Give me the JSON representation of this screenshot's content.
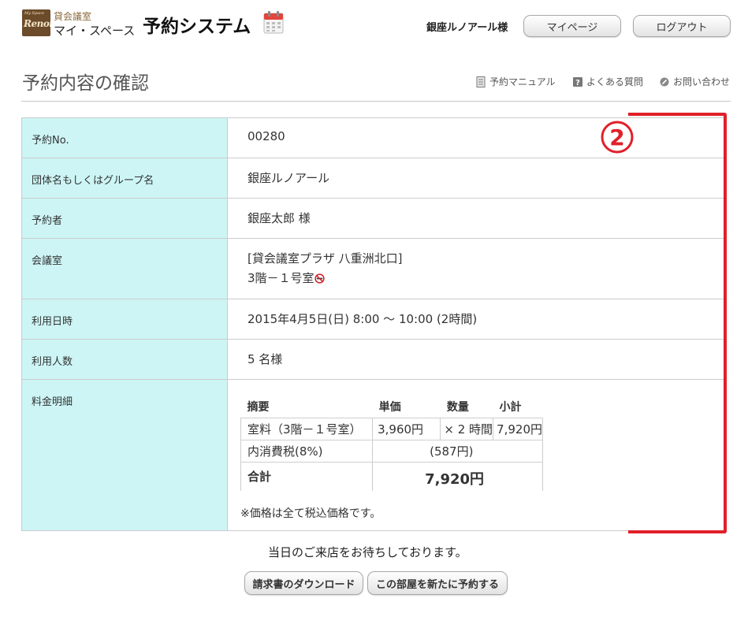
{
  "header": {
    "logo": {
      "small_text": "My Space",
      "script_text": "Renoir"
    },
    "brand_line1": "貸会議室",
    "brand_line2": "マイ・スペース",
    "system_title": "予約システム",
    "user_name": "銀座ルノアール様",
    "mypage_label": "マイページ",
    "logout_label": "ログアウト"
  },
  "page": {
    "title": "予約内容の確認",
    "links": [
      {
        "label": "予約マニュアル",
        "icon": "manual-icon"
      },
      {
        "label": "よくある質問",
        "icon": "question-icon"
      },
      {
        "label": "お問い合わせ",
        "icon": "contact-icon"
      }
    ]
  },
  "reservation": {
    "rows": [
      {
        "label": "予約No.",
        "value": "00280"
      },
      {
        "label": "団体名もしくはグループ名",
        "value": "銀座ルノアール"
      },
      {
        "label": "予約者",
        "value": "銀座太郎 様"
      },
      {
        "label": "会議室",
        "value_line1": "[貸会議室プラザ 八重洲北口]",
        "value_line2": "3階－１号室"
      },
      {
        "label": "利用日時",
        "value": "2015年4月5日(日) 8:00 ～ 10:00 (2時間)"
      },
      {
        "label": "利用人数",
        "value": "5 名様"
      },
      {
        "label": "料金明細"
      }
    ]
  },
  "fee": {
    "headers": [
      "摘要",
      "単価",
      "数量",
      "小計"
    ],
    "item": {
      "desc": "室料（3階－１号室）",
      "unit_price": "3,960円",
      "qty": "× 2 時間",
      "subtotal": "7,920円"
    },
    "tax": {
      "desc": "内消費税(8%)",
      "amount": "(587円)"
    },
    "total": {
      "label": "合計",
      "amount": "7,920円"
    },
    "note": "※価格は全て税込価格です。"
  },
  "annotation": {
    "number": "2",
    "color": "#e0202a"
  },
  "footer": {
    "message": "当日のご来店をお待ちしております。",
    "download_label": "請求書のダウンロード",
    "rebook_label": "この部屋を新たに予約する"
  },
  "colors": {
    "label_bg": "#cdf5f5",
    "border": "#cccccc",
    "brand_brown": "#6b4b2a"
  }
}
